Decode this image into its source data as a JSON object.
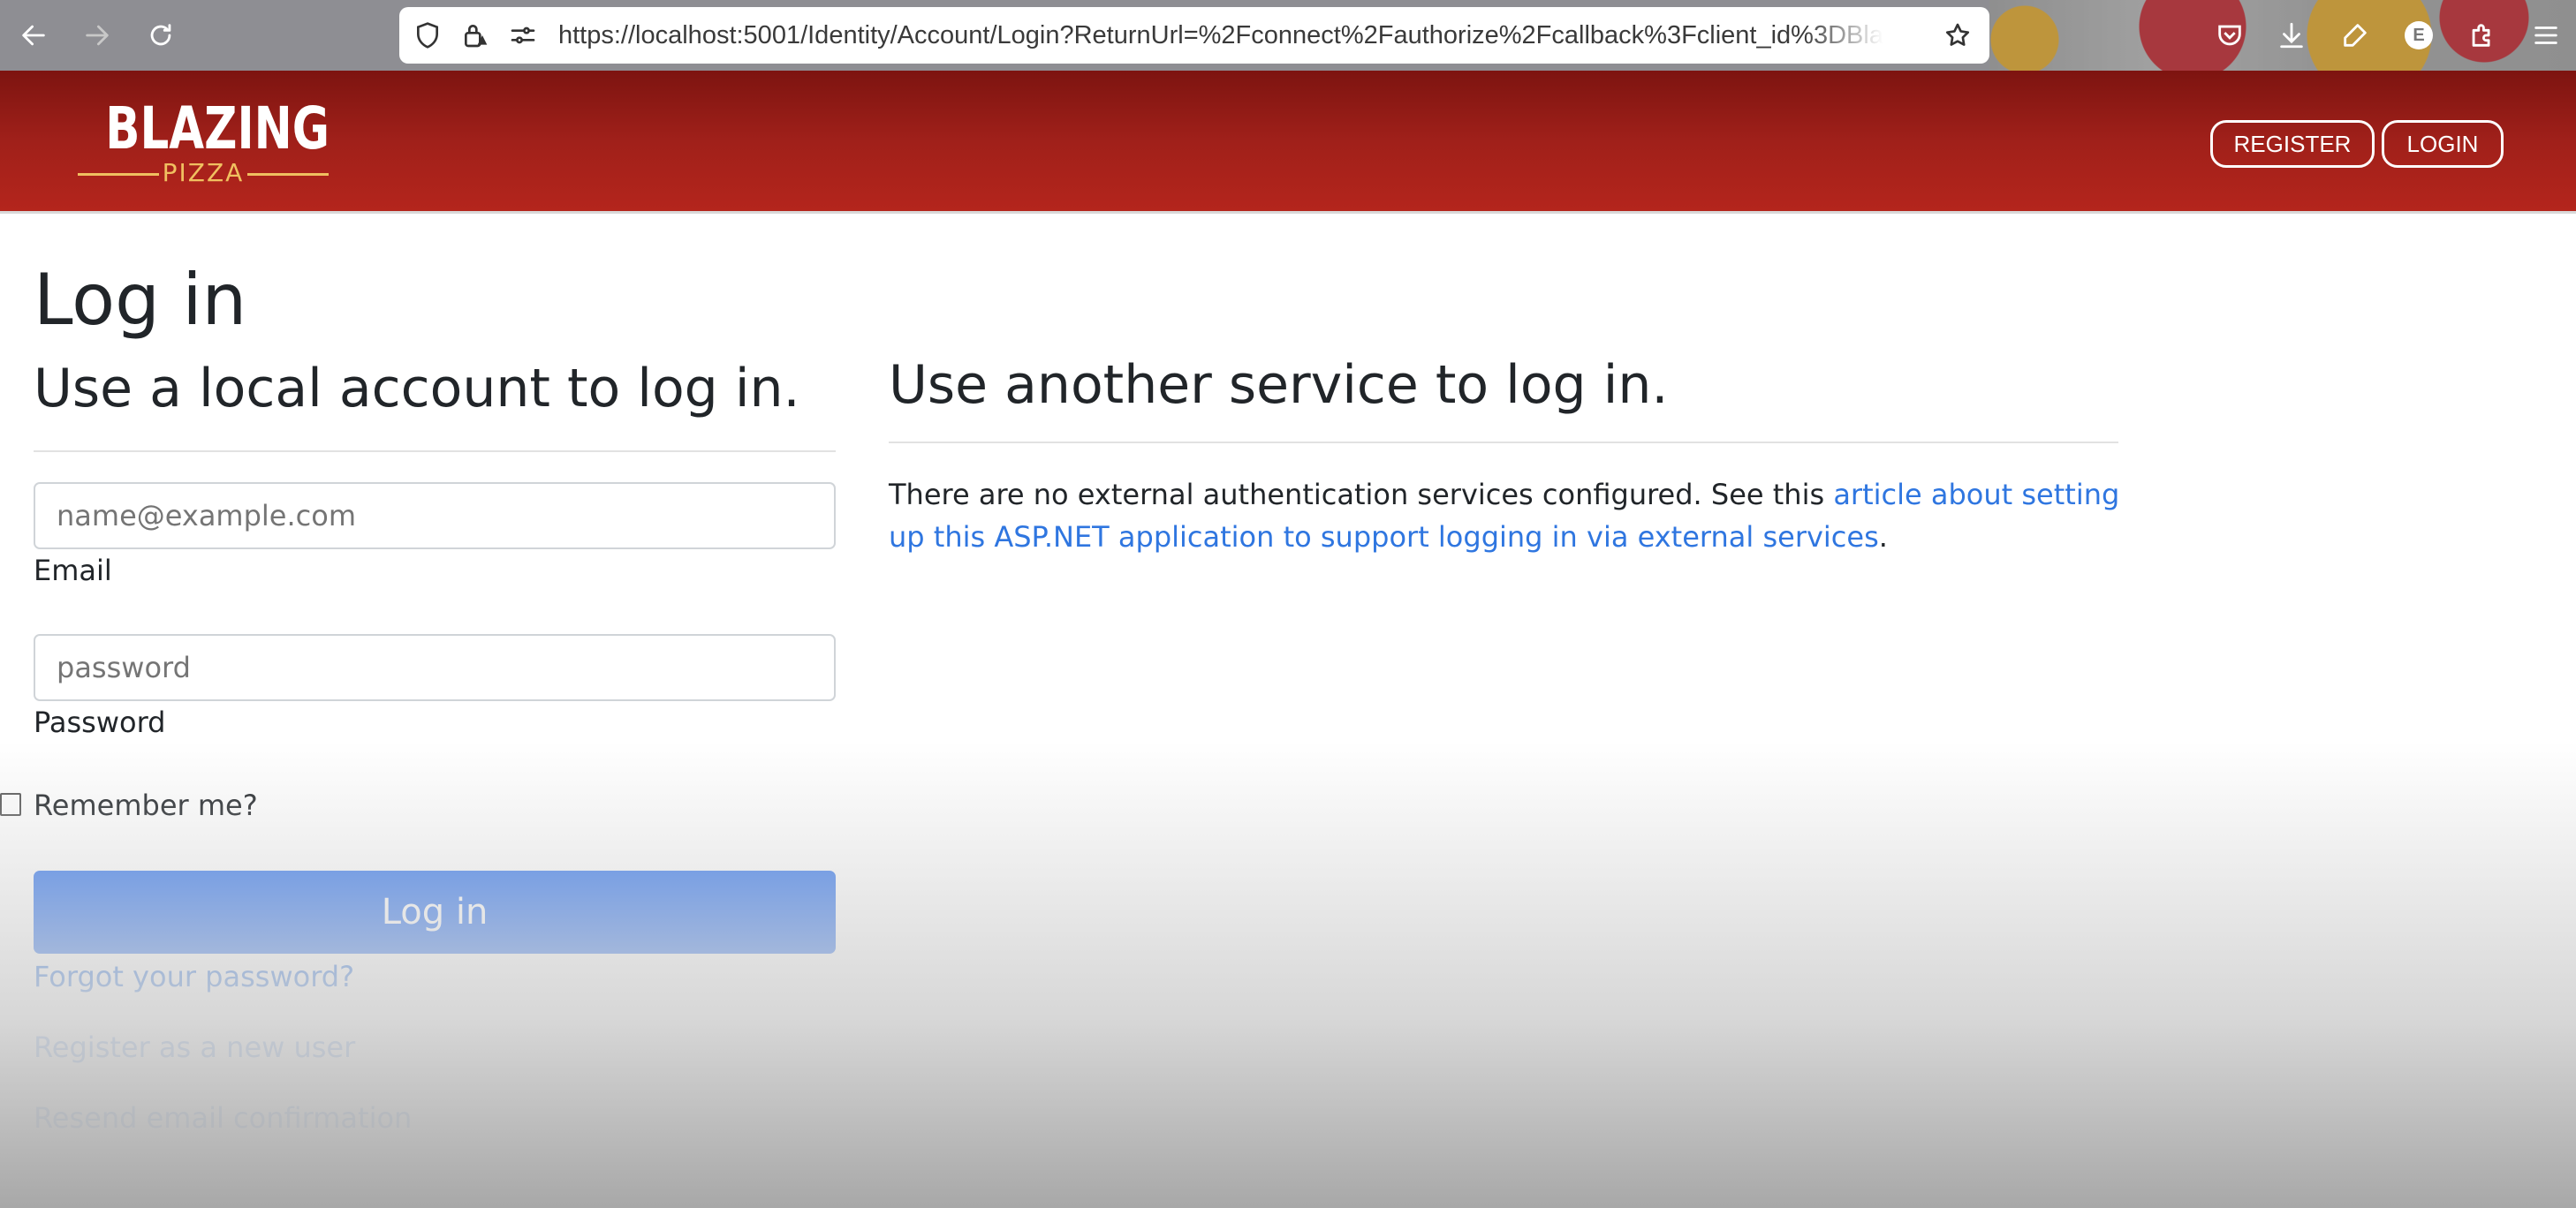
{
  "browser": {
    "url": "https://localhost:5001/Identity/Account/Login?ReturnUrl=%2Fconnect%2Fauthorize%2Fcallback%3Fclient_id%3DBlazin",
    "profile_initial": "E",
    "icons": [
      "back-icon",
      "forward-icon",
      "reload-icon",
      "shield-icon",
      "lock-warning-icon",
      "site-settings-icon",
      "bookmark-star-icon",
      "pocket-icon",
      "download-icon",
      "tools-icon",
      "profile-icon",
      "extensions-icon",
      "menu-icon"
    ]
  },
  "header": {
    "logo_main": "BLAZING",
    "logo_sub": "PIZZA",
    "register_label": "REGISTER",
    "login_label": "LOGIN",
    "brand_color": "#a8221a"
  },
  "page": {
    "title": "Log in",
    "local_heading": "Use a local account to log in.",
    "external_heading": "Use another service to log in.",
    "email_placeholder": "name@example.com",
    "email_label": "Email",
    "password_placeholder": "password",
    "password_label": "Password",
    "remember_label": "Remember me?",
    "login_button": "Log in",
    "forgot_link": "Forgot your password?",
    "register_link": "Register as a new user",
    "resend_link": "Resend email confirmation",
    "external_text": "There are no external authentication services configured. See this ",
    "external_link": "article about setting up this ASP.NET application to support logging in via external services",
    "external_text_end": ".",
    "accent_color": "#3b7cf0",
    "link_color": "#2f76e0"
  }
}
